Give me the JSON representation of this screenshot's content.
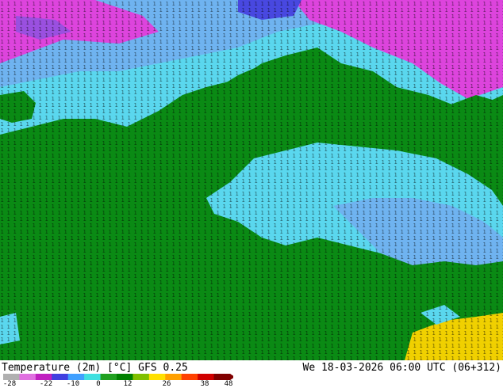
{
  "map": {
    "name": "temperature-2m-map",
    "grid_numbers_note_visible": false
  },
  "footer": {
    "title": "Temperature (2m) [°C] GFS 0.25",
    "datetime": "We 18-03-2026 06:00 UTC (06+312)"
  },
  "legend": {
    "ticks": [
      "-28",
      "-22",
      "-10",
      "0",
      "12",
      "26",
      "38",
      "48"
    ],
    "colors": [
      "#b0b0b0",
      "#e070e0",
      "#c020c0",
      "#4040e0",
      "#40a0ff",
      "#40e0e0",
      "#20a020",
      "#008000",
      "#80c000",
      "#ffe000",
      "#ffa000",
      "#ff4000",
      "#d00000",
      "#800000"
    ]
  },
  "palette": {
    "green": "#008000",
    "cyan": "#55d8ee",
    "light_blue": "#7ab8f0",
    "magenta": "#dd44dd",
    "violet": "#6060e0",
    "yellow": "#f0d000"
  }
}
